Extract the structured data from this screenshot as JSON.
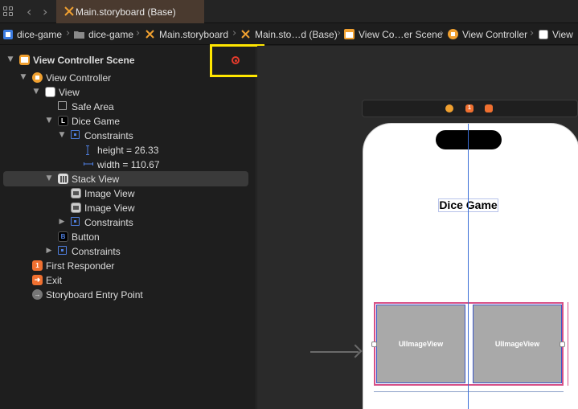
{
  "tab": {
    "label": "Main.storyboard (Base)"
  },
  "jumpbar": {
    "crumbs": [
      "dice-game",
      "dice-game",
      "Main.storyboard",
      "Main.sto…d (Base)",
      "View Co…er Scene",
      "View Controller",
      "View"
    ]
  },
  "outline": {
    "rows": [
      {
        "label": "View Controller Scene"
      },
      {
        "label": "View Controller"
      },
      {
        "label": "View"
      },
      {
        "label": "Safe Area"
      },
      {
        "label": "Dice Game"
      },
      {
        "label": "Constraints"
      },
      {
        "label": "height = 26.33"
      },
      {
        "label": "width = 110.67"
      },
      {
        "label": "Stack View"
      },
      {
        "label": "Image View"
      },
      {
        "label": "Image View"
      },
      {
        "label": "Constraints"
      },
      {
        "label": "Button"
      },
      {
        "label": "Constraints"
      },
      {
        "label": "First Responder"
      },
      {
        "label": "Exit"
      },
      {
        "label": "Storyboard Entry Point"
      }
    ]
  },
  "canvas": {
    "title_label": "Dice Game",
    "image_view_left": "UIImageView",
    "image_view_right": "UIImageView"
  },
  "icons": {
    "label_icon_glyph": "L",
    "button_icon_glyph": "B",
    "first_responder_glyph": "1"
  },
  "colors": {
    "accent_orange": "#f0a030",
    "selection": "#3a3a3a",
    "highlight_box": "#ffe600",
    "constraint_pink": "#d65086",
    "constraint_blue": "#3c6fd6"
  }
}
